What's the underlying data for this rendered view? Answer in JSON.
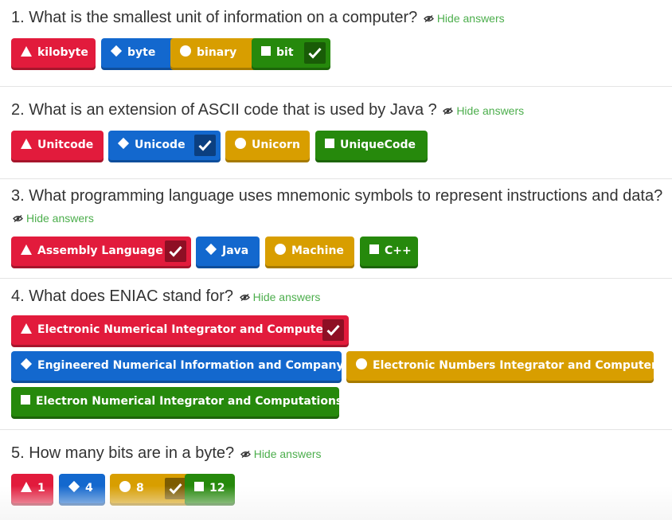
{
  "hide_label": "Hide answers",
  "questions": [
    {
      "title": "1. What is the smallest unit of information on a computer?",
      "answers": [
        {
          "label": "kilobyte",
          "color": "#e21b3c",
          "shape": "triangle",
          "correct": false
        },
        {
          "label": "byte",
          "color": "#1368ce",
          "shape": "diamond",
          "correct": false
        },
        {
          "label": "binary",
          "color": "#d89e00",
          "shape": "circle",
          "correct": false
        },
        {
          "label": "bit",
          "color": "#26890c",
          "shape": "square",
          "correct": true
        }
      ]
    },
    {
      "title": "2. What is an extension of ASCII code that is used by Java ?",
      "answers": [
        {
          "label": "Unitcode",
          "color": "#e21b3c",
          "shape": "triangle",
          "correct": false
        },
        {
          "label": "Unicode",
          "color": "#1368ce",
          "shape": "diamond",
          "correct": true
        },
        {
          "label": "Unicorn",
          "color": "#d89e00",
          "shape": "circle",
          "correct": false
        },
        {
          "label": "UniqueCode",
          "color": "#26890c",
          "shape": "square",
          "correct": false
        }
      ]
    },
    {
      "title": "3. What programming language uses mnemonic symbols to represent instructions and data?",
      "answers": [
        {
          "label": "Assembly Language",
          "color": "#e21b3c",
          "shape": "triangle",
          "correct": true
        },
        {
          "label": "Java",
          "color": "#1368ce",
          "shape": "diamond",
          "correct": false
        },
        {
          "label": "Machine",
          "color": "#d89e00",
          "shape": "circle",
          "correct": false
        },
        {
          "label": "C++",
          "color": "#26890c",
          "shape": "square",
          "correct": false
        }
      ]
    },
    {
      "title": "4. What does ENIAC stand for?",
      "answers": [
        {
          "label": "Electronic Numerical Integrator and Computer",
          "color": "#e21b3c",
          "shape": "triangle",
          "correct": true
        },
        {
          "label": "Engineered Numerical Information and Company",
          "color": "#1368ce",
          "shape": "diamond",
          "correct": false
        },
        {
          "label": "Electronic Numbers Integrator and Computer",
          "color": "#d89e00",
          "shape": "circle",
          "correct": false
        },
        {
          "label": "Electron Numerical Integrator and Computations",
          "color": "#26890c",
          "shape": "square",
          "correct": false
        }
      ]
    },
    {
      "title": "5. How many bits are in a byte?",
      "answers": [
        {
          "label": "1",
          "color": "#e21b3c",
          "shape": "triangle",
          "correct": false
        },
        {
          "label": "4",
          "color": "#1368ce",
          "shape": "diamond",
          "correct": false
        },
        {
          "label": "8",
          "color": "#d89e00",
          "shape": "circle",
          "correct": true
        },
        {
          "label": "12",
          "color": "#26890c",
          "shape": "square",
          "correct": false
        }
      ]
    }
  ]
}
